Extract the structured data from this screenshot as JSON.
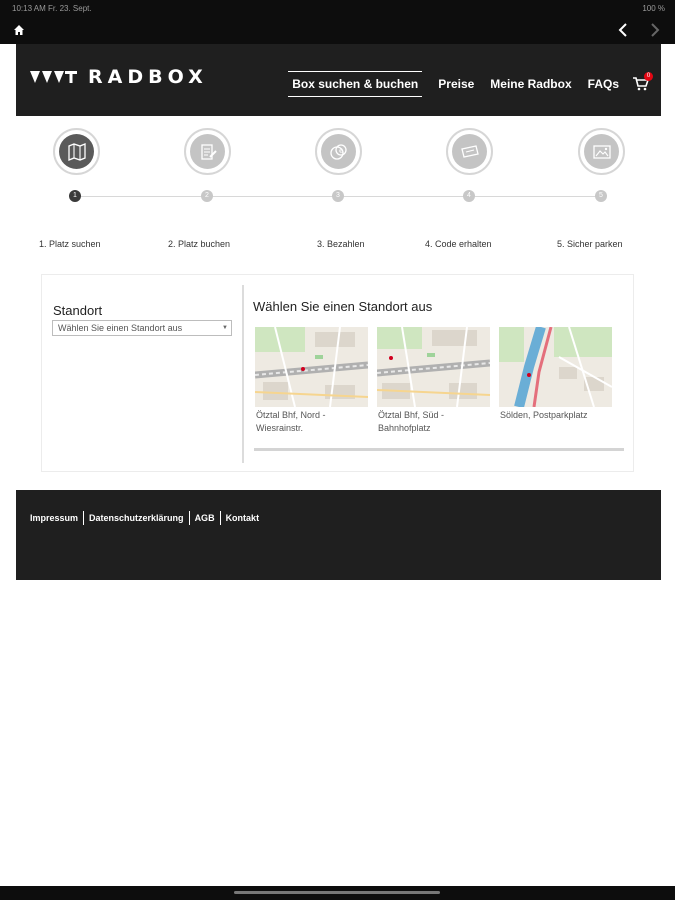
{
  "statusbar": {
    "time": "10:13 AM   Fr. 23. Sept.",
    "battery": "100 %"
  },
  "brand": {
    "name": "RADBOX"
  },
  "nav": {
    "items": [
      "Box suchen & buchen",
      "Preise",
      "Meine Radbox",
      "FAQs"
    ],
    "cart_count": "0"
  },
  "steps": [
    {
      "number": "1",
      "label": "1. Platz suchen",
      "icon": "map-search-icon"
    },
    {
      "number": "2",
      "label": "2. Platz buchen",
      "icon": "edit-form-icon"
    },
    {
      "number": "3",
      "label": "3. Bezahlen",
      "icon": "coins-icon"
    },
    {
      "number": "4",
      "label": "4. Code erhalten",
      "icon": "ticket-code-icon"
    },
    {
      "number": "5",
      "label": "5. Sicher parken",
      "icon": "parking-photo-icon"
    }
  ],
  "search": {
    "standort_label": "Standort",
    "select_value": "Wählen Sie einen Standort aus",
    "section_title": "Wählen Sie einen Standort aus"
  },
  "locations": [
    {
      "line1": "Ötztal Bhf, Nord -",
      "line2": "Wiesrainstr."
    },
    {
      "line1": "Ötztal Bhf, Süd -",
      "line2": "Bahnhofplatz"
    },
    {
      "line1": "Sölden, Postparkplatz",
      "line2": ""
    }
  ],
  "footer": {
    "links": [
      "Impressum",
      "Datenschutzerklärung",
      "AGB",
      "Kontakt"
    ]
  },
  "colors": {
    "header_bg": "#1f1f1f",
    "accent_red": "#e30613",
    "step_active": "#5a5a5a",
    "step_inactive": "#c4c4c4"
  }
}
